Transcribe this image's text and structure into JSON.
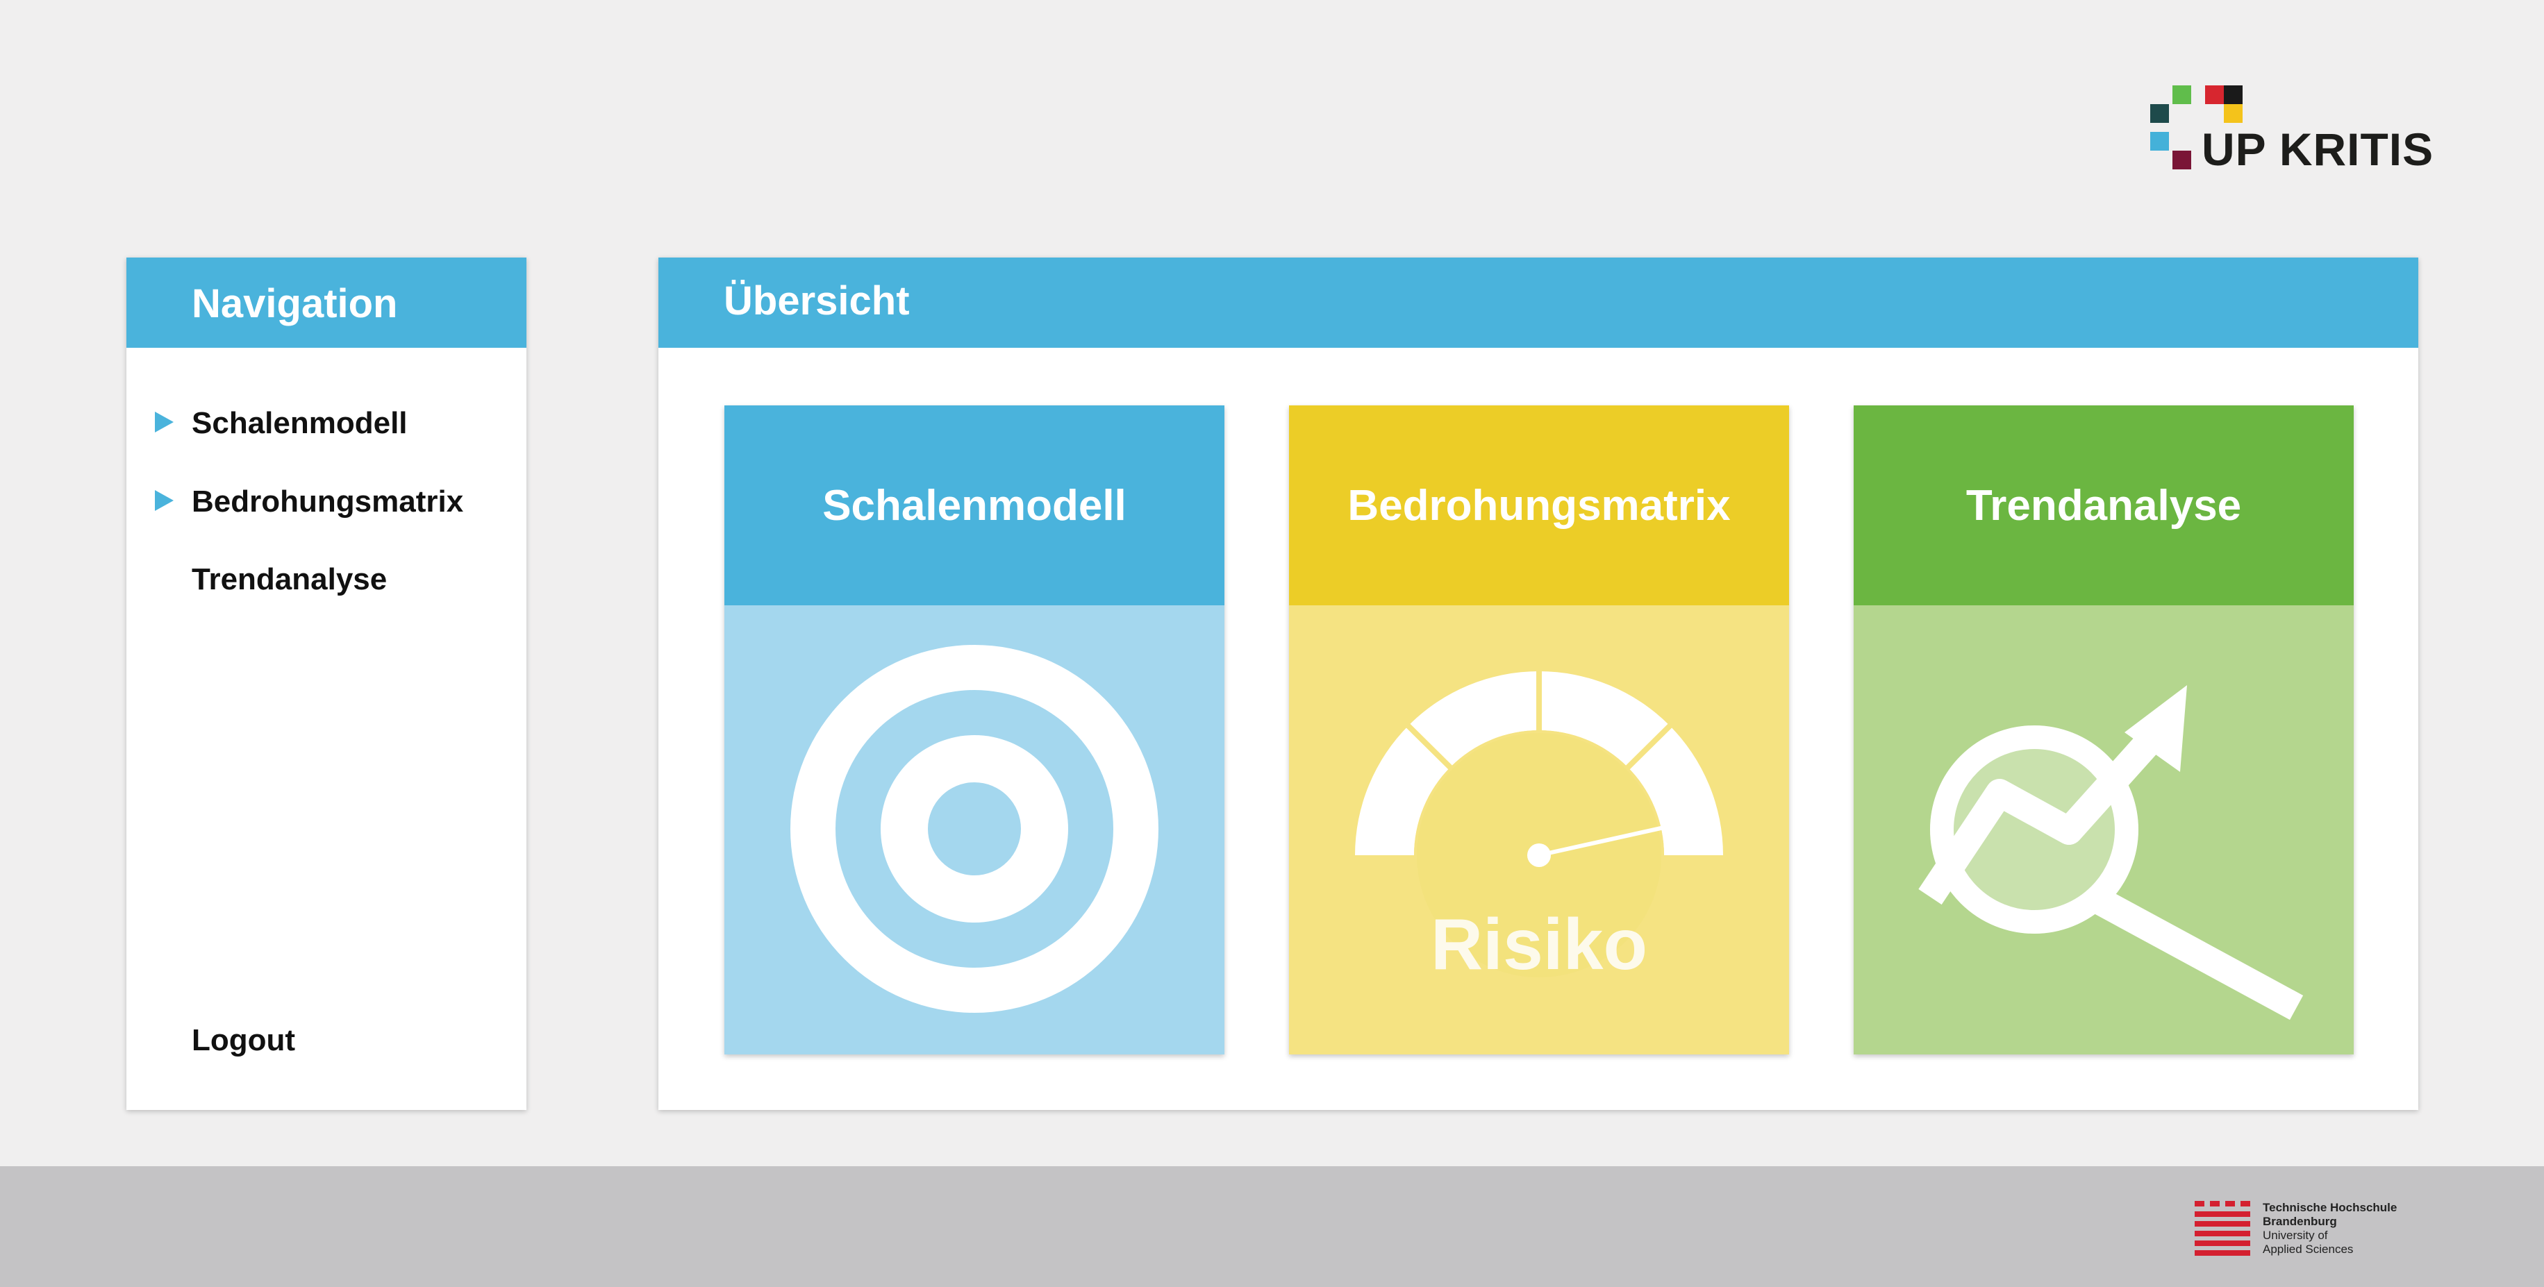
{
  "brand": {
    "name": "UP KRITIS",
    "square_colors": [
      "#1e4a4b",
      "#60bd4b",
      "#d7262f",
      "#1a1a1a",
      "#f4c31b",
      "#44b1d9",
      "#7a1536"
    ]
  },
  "navigation": {
    "title": "Navigation",
    "items": [
      {
        "label": "Schalenmodell",
        "has_arrow": true
      },
      {
        "label": "Bedrohungsmatrix",
        "has_arrow": true
      },
      {
        "label": "Trendanalyse",
        "has_arrow": false
      }
    ],
    "logout_label": "Logout"
  },
  "overview": {
    "title": "Übersicht",
    "tiles": [
      {
        "label": "Schalenmodell",
        "icon": "target-icon",
        "head_color": "#4ab3dc",
        "body_color": "#a4d7ee"
      },
      {
        "label": "Bedrohungsmatrix",
        "icon": "gauge-icon",
        "head_color": "#eccd27",
        "body_color": "#f5e382",
        "icon_text": "Risiko"
      },
      {
        "label": "Trendanalyse",
        "icon": "trend-magnifier-icon",
        "head_color": "#6bb641",
        "body_color": "#b4d68e"
      }
    ]
  },
  "footer": {
    "university": {
      "line1": "Technische Hochschule",
      "line2": "Brandenburg",
      "line3": "University of",
      "line4": "Applied Sciences",
      "color": "#d42030"
    }
  },
  "colors": {
    "accent": "#4ab3dc",
    "page_background": "#f0efef",
    "footer_background": "#c4c3c5"
  }
}
